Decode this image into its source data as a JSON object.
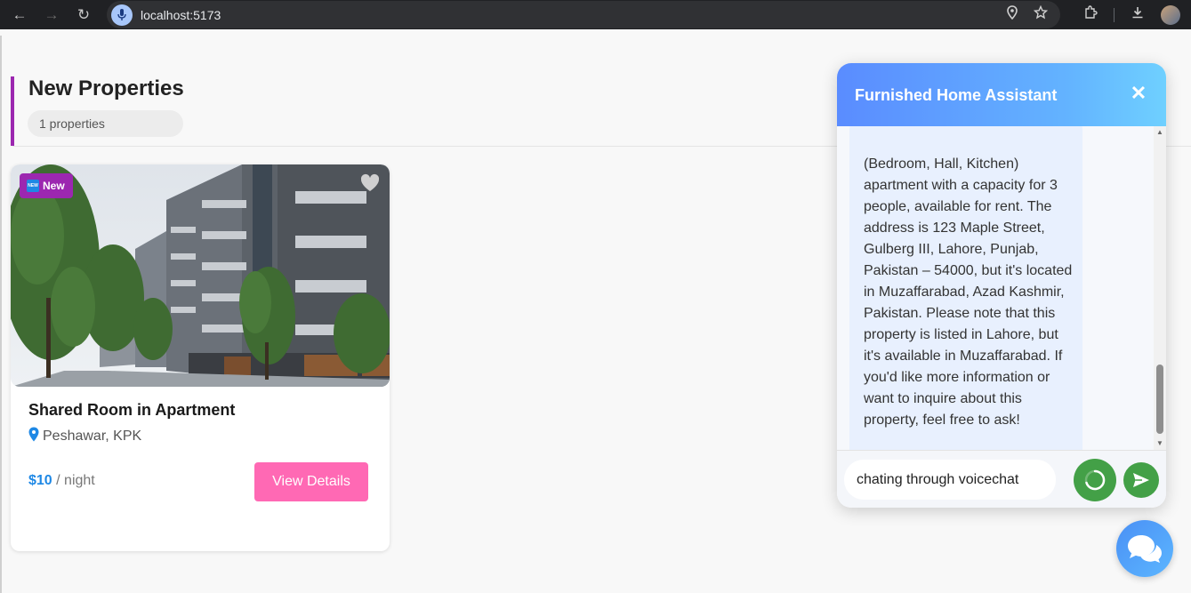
{
  "browser": {
    "url": "localhost:5173"
  },
  "section": {
    "title": "New Properties",
    "count_label": "1 properties"
  },
  "property": {
    "badge": "New",
    "title": "Shared Room in Apartment",
    "location": "Peshawar, KPK",
    "price": "$10",
    "price_unit": " / night",
    "view_button": "View Details"
  },
  "chat": {
    "title": "Furnished Home Assistant",
    "message": "(Bedroom, Hall, Kitchen) apartment with a capacity for 3 people, available for rent. The address is 123 Maple Street, Gulberg III, Lahore, Punjab, Pakistan – 54000, but it's located in Muzaffarabad, Azad Kashmir, Pakistan. Please note that this property is listed in Lahore, but it's available in Muzaffarabad. If you'd like more information or want to inquire about this property, feel free to ask!",
    "input_value": "chating through voicechat"
  },
  "colors": {
    "accent_purple": "#9c27b0",
    "price_blue": "#1e88e5",
    "view_button_pink": "#ff69b4",
    "chat_green": "#43a047"
  }
}
